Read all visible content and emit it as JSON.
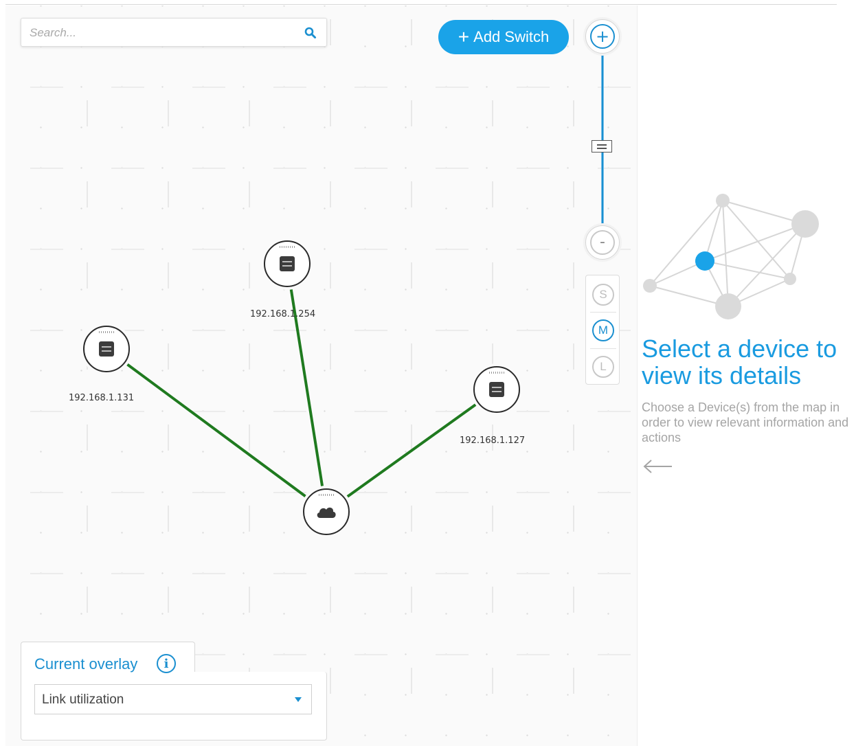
{
  "search": {
    "placeholder": "Search..."
  },
  "toolbar": {
    "add_switch_label": "Add Switch",
    "add_switch_prefix": "+"
  },
  "zoom": {
    "in_label": "+",
    "out_label": "-",
    "level": 0.54
  },
  "node_size": {
    "options": [
      "S",
      "M",
      "L"
    ],
    "selected": "M"
  },
  "nodes": [
    {
      "type": "switch",
      "label": "192.168.1.254"
    },
    {
      "type": "switch",
      "label": "192.168.1.131"
    },
    {
      "type": "switch",
      "label": "192.168.1.127"
    },
    {
      "type": "cloud",
      "label": ""
    }
  ],
  "links": [
    {
      "from": "192.168.1.254",
      "to": "cloud",
      "color": "#1f7a1f"
    },
    {
      "from": "192.168.1.131",
      "to": "cloud",
      "color": "#1f7a1f"
    },
    {
      "from": "192.168.1.127",
      "to": "cloud",
      "color": "#1f7a1f"
    }
  ],
  "overlay": {
    "title": "Current overlay",
    "info_icon": "info-icon",
    "selected": "Link utilization"
  },
  "details": {
    "heading": "Select a device to view its details",
    "description": "Choose a Device(s) from the map in order to view relevant information and actions"
  },
  "colors": {
    "accent": "#1aa3e8",
    "link_ok": "#1f7a1f"
  }
}
